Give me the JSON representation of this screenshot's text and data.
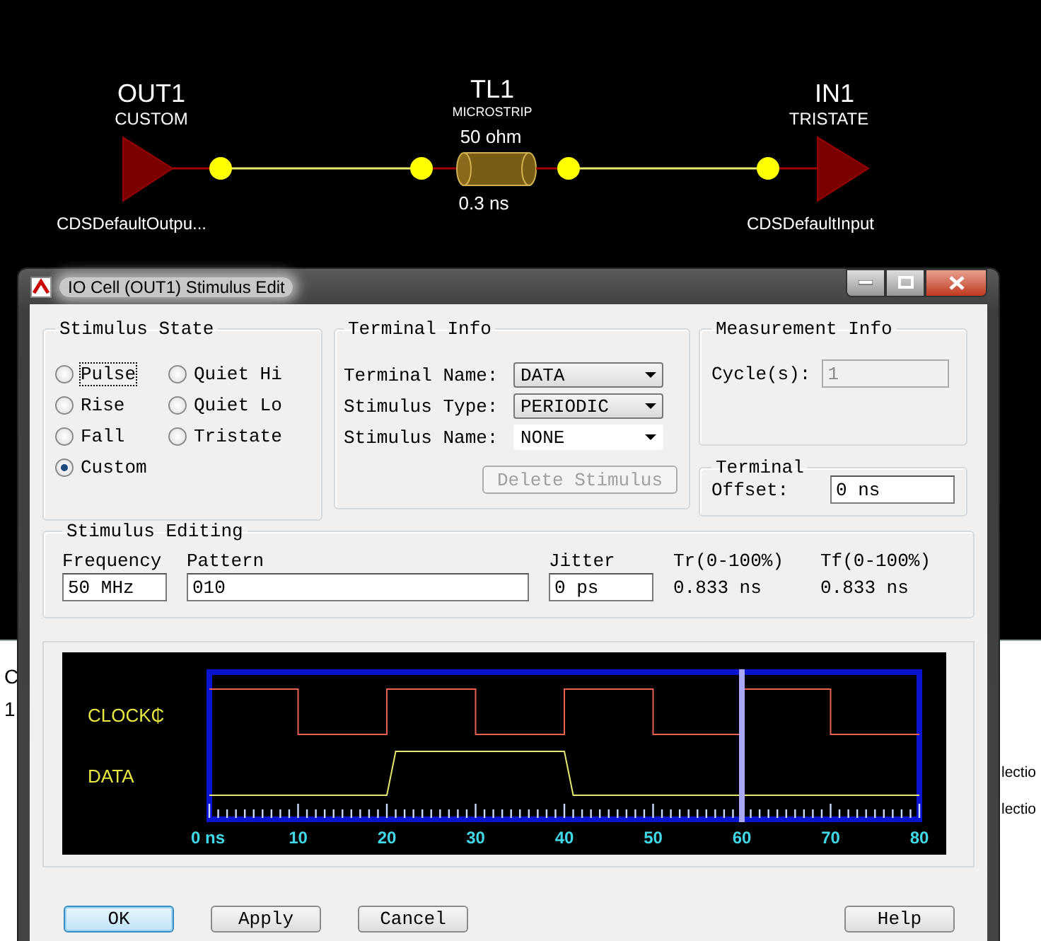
{
  "schematic": {
    "parts": [
      {
        "kind": "driver",
        "name": "OUT1",
        "mode": "CUSTOM",
        "model": "CDSDefaultOutpu..."
      },
      {
        "kind": "line",
        "name": "TL1",
        "type": "MICROSTRIP",
        "impedance": "50 ohm",
        "delay": "0.3 ns"
      },
      {
        "kind": "receiver",
        "name": "IN1",
        "mode": "TRISTATE",
        "model": "CDSDefaultInput"
      }
    ]
  },
  "background_window": {
    "column_header": "C",
    "cell": "1",
    "items": [
      "lectio",
      "lectio"
    ]
  },
  "dialog": {
    "title": "IO Cell (OUT1) Stimulus Edit",
    "stimulus_state": {
      "title": "Stimulus State",
      "options": [
        {
          "label": "Pulse",
          "selected": false,
          "focused": true
        },
        {
          "label": "Quiet Hi",
          "selected": false,
          "focused": false
        },
        {
          "label": "Rise",
          "selected": false,
          "focused": false
        },
        {
          "label": "Quiet Lo",
          "selected": false,
          "focused": false
        },
        {
          "label": "Fall",
          "selected": false,
          "focused": false
        },
        {
          "label": "Tristate",
          "selected": false,
          "focused": false
        },
        {
          "label": "Custom",
          "selected": true,
          "focused": false
        }
      ]
    },
    "terminal_info": {
      "title": "Terminal Info",
      "fields": [
        {
          "label": "Terminal Name:",
          "value": "DATA",
          "kind": "dropdown"
        },
        {
          "label": "Stimulus Type:",
          "value": "PERIODIC",
          "kind": "dropdown"
        },
        {
          "label": "Stimulus Name:",
          "value": "NONE",
          "kind": "combo"
        }
      ],
      "delete_button": {
        "label": "Delete Stimulus",
        "disabled": true
      }
    },
    "measurement_info": {
      "title": "Measurement Info",
      "label": "Cycle(s):",
      "value": "1",
      "disabled": true
    },
    "terminal": {
      "title": "Terminal",
      "label": "Offset:",
      "value": "0 ns"
    },
    "stimulus_editing": {
      "title": "Stimulus Editing",
      "columns": [
        {
          "label": "Frequency",
          "value": "50 MHz",
          "kind": "input"
        },
        {
          "label": "Pattern",
          "value": "010",
          "kind": "input"
        },
        {
          "label": "Jitter",
          "value": "0 ps",
          "kind": "input"
        },
        {
          "label": "Tr(0-100%)",
          "value": "0.833 ns",
          "kind": "readout"
        },
        {
          "label": "Tf(0-100%)",
          "value": "0.833 ns",
          "kind": "readout"
        }
      ]
    },
    "waveform": {
      "signals": [
        "CLOCK₵",
        "DATA"
      ],
      "time_labels": [
        "0 ns",
        "10",
        "20",
        "30",
        "40",
        "50",
        "60",
        "70",
        "80"
      ]
    },
    "buttons": [
      {
        "label": "OK",
        "default": true
      },
      {
        "label": "Apply",
        "default": false
      },
      {
        "label": "Cancel",
        "default": false
      },
      {
        "label": "Help",
        "default": false
      }
    ]
  }
}
